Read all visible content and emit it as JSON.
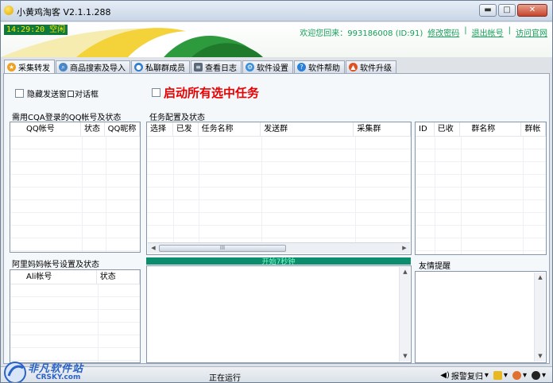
{
  "window": {
    "title": "小黄鸡淘客 V2.1.1.288",
    "controls": {
      "minimize": "▬",
      "maximize": "□",
      "close": "✕"
    }
  },
  "banner": {
    "clock": "14:29:20 空闲",
    "welcome": "欢迎您回来：993186008 (ID:91)",
    "links": [
      "修改密码",
      "退出帐号",
      "访问官网"
    ],
    "separator": "|"
  },
  "tabs": [
    {
      "label": "采集转发",
      "icon": "star-icon",
      "color": "#f0a020",
      "active": true
    },
    {
      "label": "商品搜索及导入",
      "icon": "search-icon",
      "color": "#4a86c8",
      "active": false
    },
    {
      "label": "私聊群成员",
      "icon": "chat-icon",
      "color": "#2f7fd0",
      "active": false
    },
    {
      "label": "查看日志",
      "icon": "log-icon",
      "color": "#5a6a7a",
      "active": false
    },
    {
      "label": "软件设置",
      "icon": "gear-icon",
      "color": "#3b8fd8",
      "active": false
    },
    {
      "label": "软件帮助",
      "icon": "help-icon",
      "color": "#2a7fd6",
      "active": false
    },
    {
      "label": "软件升级",
      "icon": "upgrade-icon",
      "color": "#e05020",
      "active": false
    }
  ],
  "options": {
    "hide_send_window": "隐藏发送窗口对话框",
    "start_all": "启动所有选中任务"
  },
  "qq_accounts": {
    "title": "需用CQA登录的QQ帐号及状态",
    "columns": [
      "QQ帐号",
      "状态",
      "QQ昵称"
    ]
  },
  "tasks": {
    "title": "任务配置及状态",
    "columns": [
      "选择",
      "已发",
      "任务名称",
      "发送群",
      "采集群"
    ],
    "scroll_thumb": "III"
  },
  "groups": {
    "columns": [
      "ID",
      "已收",
      "群名称",
      "群帐"
    ]
  },
  "ali_accounts": {
    "title": "阿里妈妈帐号设置及状态",
    "columns": [
      "Ali帐号",
      "状态"
    ]
  },
  "progress": {
    "label": "开始7秒钟",
    "percent": 100
  },
  "friendly_tips": {
    "title": "友情提醒"
  },
  "status": {
    "text": "正在运行",
    "tray": [
      "报警复归",
      "",
      "",
      ""
    ]
  },
  "watermark": {
    "name": "非凡软件站",
    "site": "CRSKY.com"
  }
}
